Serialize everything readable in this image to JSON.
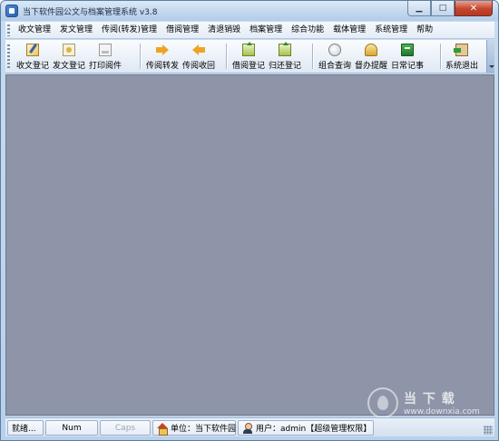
{
  "window": {
    "title": "当下软件园公文与档案管理系统 v3.8",
    "min_symbol": "▁",
    "max_symbol": "□",
    "close_symbol": "✕"
  },
  "menu": {
    "items": [
      "收文管理",
      "发文管理",
      "传阅(转发)管理",
      "借阅管理",
      "清退销毁",
      "档案管理",
      "综合功能",
      "载体管理",
      "系统管理",
      "帮助"
    ]
  },
  "toolbar": {
    "groups": [
      [
        {
          "label": "收文登记",
          "icon": "receive-register-icon"
        },
        {
          "label": "发文登记",
          "icon": "dispatch-register-icon"
        },
        {
          "label": "打印阅件",
          "icon": "print-document-icon"
        }
      ],
      [
        {
          "label": "传阅转发",
          "icon": "forward-arrow-icon"
        },
        {
          "label": "传阅收回",
          "icon": "recall-arrow-icon"
        }
      ],
      [
        {
          "label": "借阅登记",
          "icon": "borrow-register-icon"
        },
        {
          "label": "归还登记",
          "icon": "return-register-icon"
        }
      ],
      [
        {
          "label": "组合查询",
          "icon": "combined-query-icon"
        },
        {
          "label": "督办提醒",
          "icon": "supervise-reminder-icon"
        },
        {
          "label": "日常记事",
          "icon": "daily-notes-icon"
        }
      ],
      [
        {
          "label": "系统退出",
          "icon": "system-exit-icon"
        }
      ]
    ]
  },
  "status": {
    "ready": "就绪...",
    "num": "Num",
    "caps": "Caps",
    "unit": "单位：当下软件园",
    "user": "用户：admin【超级管理权限】"
  },
  "watermark": {
    "brand": "当 下 载",
    "url": "www.downxia.com"
  },
  "colors": {
    "client_bg": "#8f95a8",
    "close_button": "#c5442d",
    "titlebar": "#c3d8ee"
  }
}
